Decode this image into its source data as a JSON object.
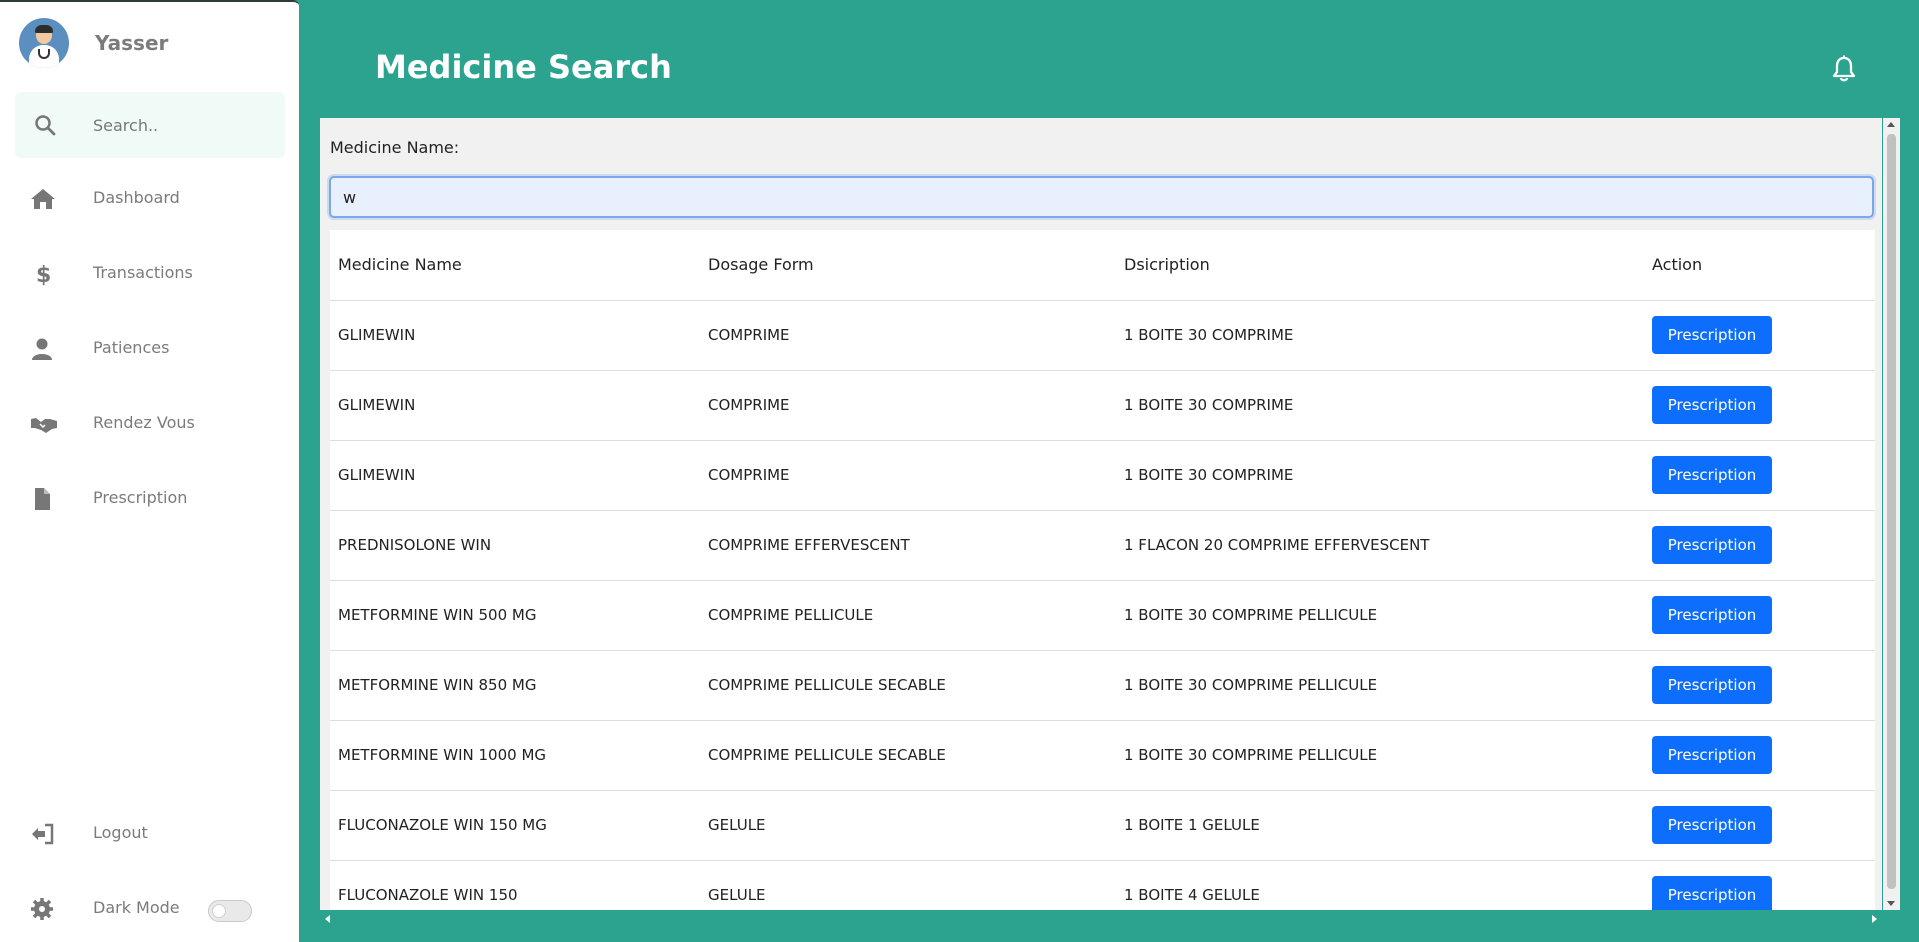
{
  "sidebar": {
    "user_name": "Yasser",
    "search_placeholder": "Search..",
    "items": [
      {
        "label": "Dashboard",
        "icon": "home-icon"
      },
      {
        "label": "Transactions",
        "icon": "dollar-icon"
      },
      {
        "label": "Patiences",
        "icon": "user-icon"
      },
      {
        "label": "Rendez Vous",
        "icon": "handshake-icon"
      },
      {
        "label": "Prescription",
        "icon": "file-icon"
      }
    ],
    "logout_label": "Logout",
    "dark_mode_label": "Dark Mode",
    "dark_mode_on": false
  },
  "header": {
    "title": "Medicine Search",
    "notification_icon": "bell-icon"
  },
  "form": {
    "label": "Medicine Name:",
    "value": "w"
  },
  "table": {
    "columns": [
      "Medicine Name",
      "Dosage Form",
      "Dsicription",
      "Action"
    ],
    "action_label": "Prescription",
    "rows": [
      {
        "name": "GLIMEWIN",
        "form": "COMPRIME",
        "desc": "1 BOITE 30 COMPRIME"
      },
      {
        "name": "GLIMEWIN",
        "form": "COMPRIME",
        "desc": "1 BOITE 30 COMPRIME"
      },
      {
        "name": "GLIMEWIN",
        "form": "COMPRIME",
        "desc": "1 BOITE 30 COMPRIME"
      },
      {
        "name": "PREDNISOLONE WIN",
        "form": "COMPRIME EFFERVESCENT",
        "desc": "1 FLACON 20 COMPRIME EFFERVESCENT"
      },
      {
        "name": "METFORMINE WIN 500 MG",
        "form": "COMPRIME PELLICULE",
        "desc": "1 BOITE 30 COMPRIME PELLICULE"
      },
      {
        "name": "METFORMINE WIN 850 MG",
        "form": "COMPRIME PELLICULE SECABLE",
        "desc": "1 BOITE 30 COMPRIME PELLICULE"
      },
      {
        "name": "METFORMINE WIN 1000 MG",
        "form": "COMPRIME PELLICULE SECABLE",
        "desc": "1 BOITE 30 COMPRIME PELLICULE"
      },
      {
        "name": "FLUCONAZOLE WIN 150 MG",
        "form": "GELULE",
        "desc": "1 BOITE 1 GELULE"
      },
      {
        "name": "FLUCONAZOLE WIN 150",
        "form": "GELULE",
        "desc": "1 BOITE 4 GELULE"
      }
    ]
  },
  "colors": {
    "background": "#2ba38e",
    "button": "#0d6efd"
  }
}
